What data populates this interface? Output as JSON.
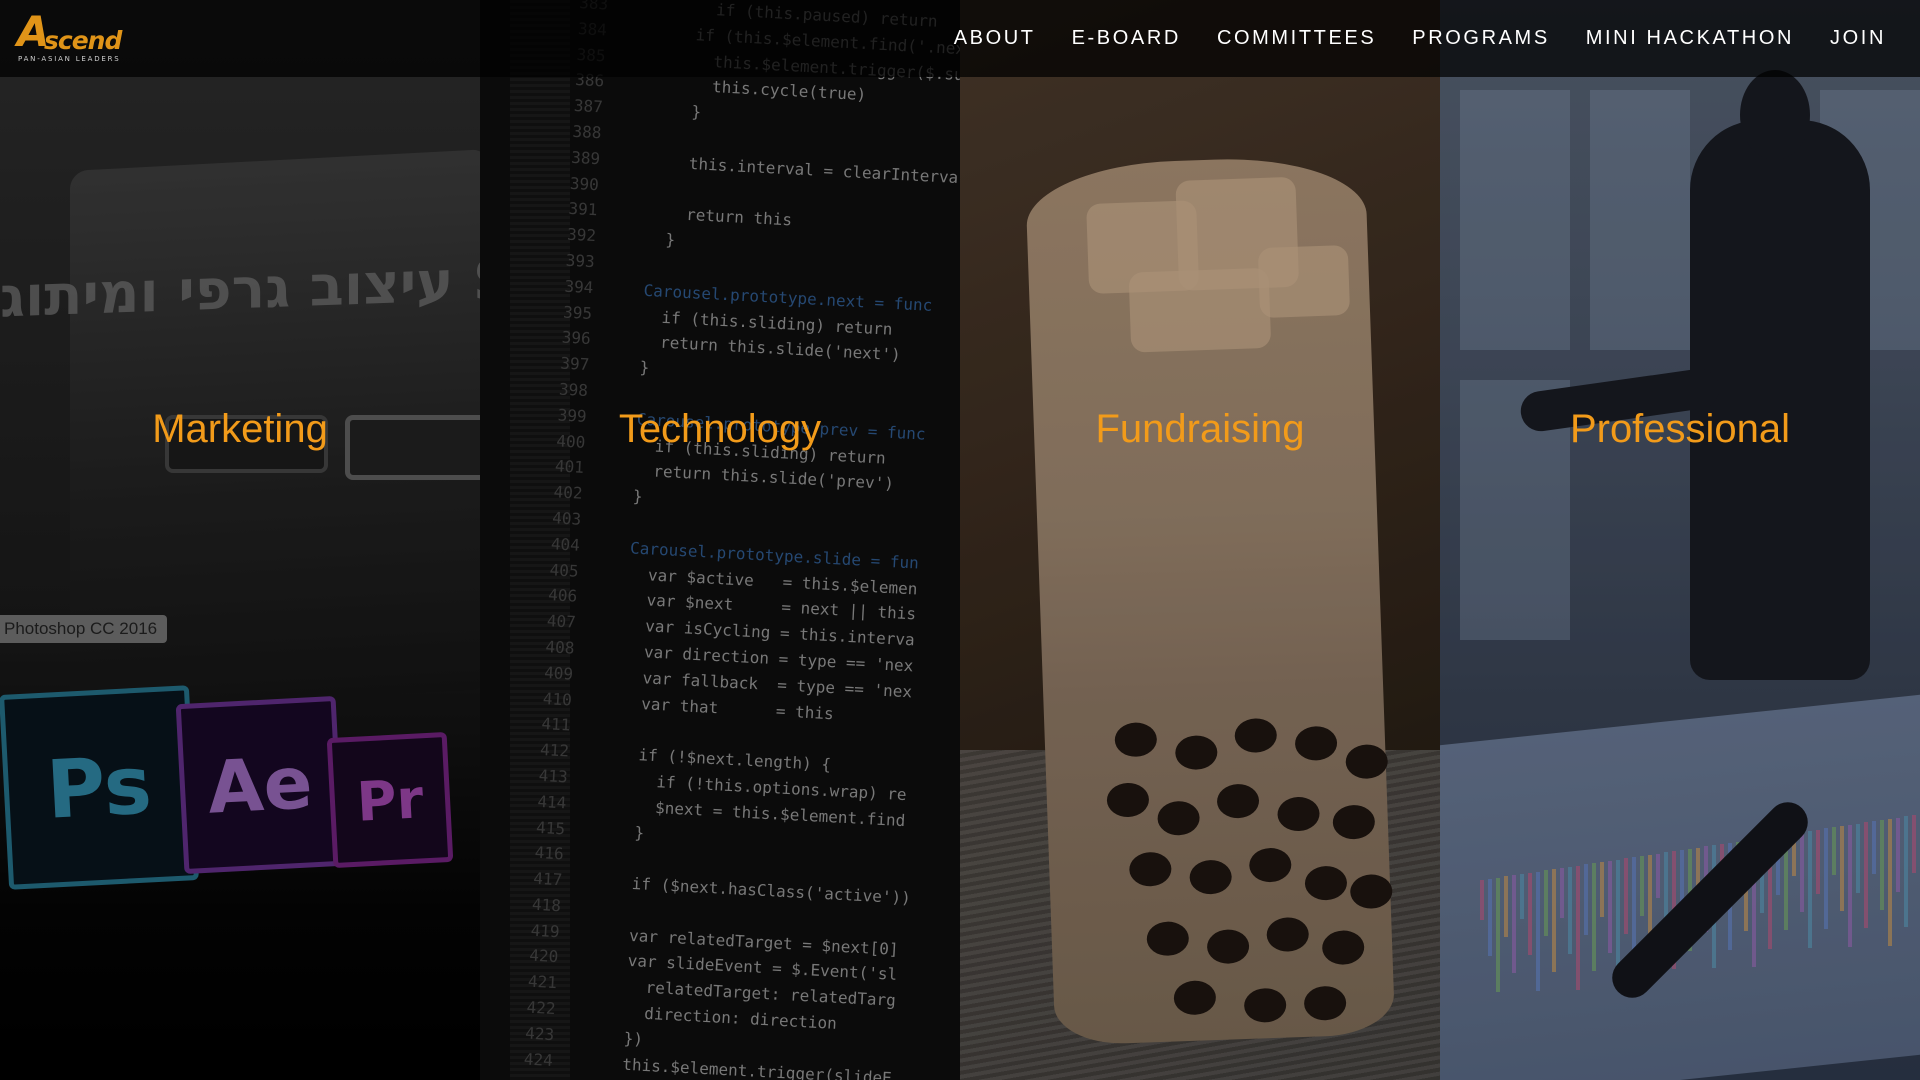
{
  "logo": {
    "main_initial": "A",
    "main_rest": "scend",
    "tagline": "PAN-ASIAN LEADERS"
  },
  "nav": {
    "links": [
      "ABOUT",
      "E-BOARD",
      "COMMITTEES",
      "PROGRAMS",
      "MINI HACKATHON",
      "JOIN"
    ]
  },
  "panels": [
    {
      "title": "Marketing"
    },
    {
      "title": "Technology"
    },
    {
      "title": "Fundraising"
    },
    {
      "title": "Professional"
    }
  ],
  "marketing_art": {
    "hebrew_text": "עיצוב גרפי ומיתוג SEO",
    "tooltip": "Photoshop CC 2016",
    "icons": [
      "Ps",
      "Ae",
      "Pr"
    ]
  },
  "tech_art": {
    "code_lines": [
      {
        "n": "383",
        "t": "        if (this.paused) return"
      },
      {
        "n": "384",
        "t": "      if (this.$element.find('.next"
      },
      {
        "n": "385",
        "t": "        this.$element.trigger($.sup"
      },
      {
        "n": "386",
        "t": "        this.cycle(true)"
      },
      {
        "n": "387",
        "t": "      }"
      },
      {
        "n": "388",
        "t": ""
      },
      {
        "n": "389",
        "t": "      this.interval = clearInterva"
      },
      {
        "n": "390",
        "t": ""
      },
      {
        "n": "391",
        "t": "      return this"
      },
      {
        "n": "392",
        "t": "    }"
      },
      {
        "n": "393",
        "t": ""
      },
      {
        "n": "394",
        "t": "  Carousel.prototype.next = func"
      },
      {
        "n": "395",
        "t": "    if (this.sliding) return"
      },
      {
        "n": "396",
        "t": "    return this.slide('next')"
      },
      {
        "n": "397",
        "t": "  }"
      },
      {
        "n": "398",
        "t": ""
      },
      {
        "n": "399",
        "t": "  Carousel.prototype.prev = func"
      },
      {
        "n": "400",
        "t": "    if (this.sliding) return"
      },
      {
        "n": "401",
        "t": "    return this.slide('prev')"
      },
      {
        "n": "402",
        "t": "  }"
      },
      {
        "n": "403",
        "t": ""
      },
      {
        "n": "404",
        "t": "  Carousel.prototype.slide = fun"
      },
      {
        "n": "405",
        "t": "    var $active   = this.$elemen"
      },
      {
        "n": "406",
        "t": "    var $next     = next || this"
      },
      {
        "n": "407",
        "t": "    var isCycling = this.interva"
      },
      {
        "n": "408",
        "t": "    var direction = type == 'nex"
      },
      {
        "n": "409",
        "t": "    var fallback  = type == 'nex"
      },
      {
        "n": "410",
        "t": "    var that      = this"
      },
      {
        "n": "411",
        "t": ""
      },
      {
        "n": "412",
        "t": "    if (!$next.length) {"
      },
      {
        "n": "413",
        "t": "      if (!this.options.wrap) re"
      },
      {
        "n": "414",
        "t": "      $next = this.$element.find"
      },
      {
        "n": "415",
        "t": "    }"
      },
      {
        "n": "416",
        "t": ""
      },
      {
        "n": "417",
        "t": "    if ($next.hasClass('active'))"
      },
      {
        "n": "418",
        "t": ""
      },
      {
        "n": "419",
        "t": "    var relatedTarget = $next[0]"
      },
      {
        "n": "420",
        "t": "    var slideEvent = $.Event('sl"
      },
      {
        "n": "421",
        "t": "      relatedTarget: relatedTarg"
      },
      {
        "n": "422",
        "t": "      direction: direction"
      },
      {
        "n": "423",
        "t": "    })"
      },
      {
        "n": "424",
        "t": "    this.$element.trigger(slideE"
      }
    ]
  },
  "colors": {
    "accent": "#f29b1a",
    "nav_text": "#ffffff",
    "navbar_bg": "rgba(0,0,0,0.72)"
  }
}
